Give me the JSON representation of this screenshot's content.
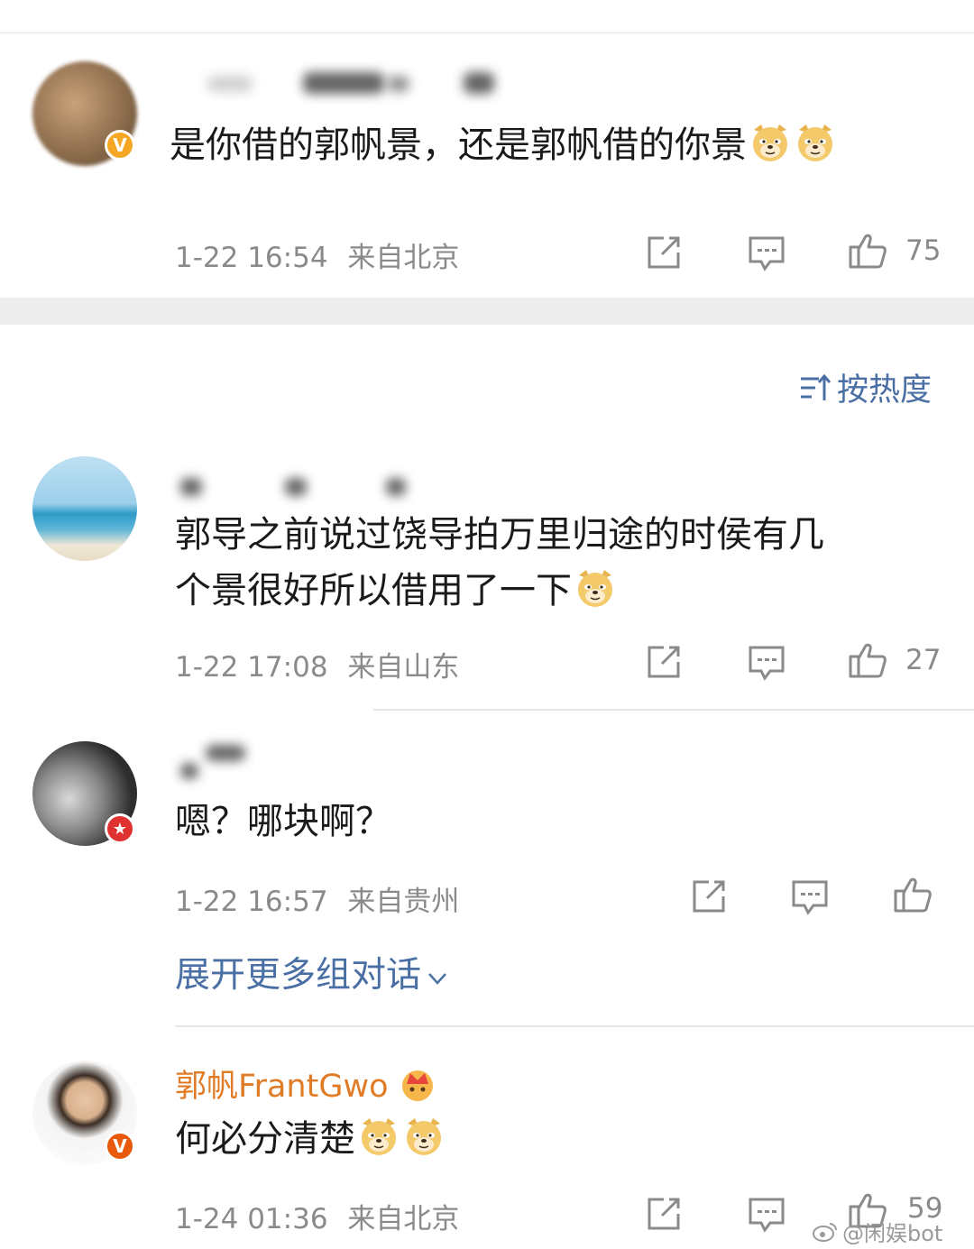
{
  "comments": [
    {
      "text": "是你借的郭帆景，还是郭帆借的你景",
      "emojis": [
        "doge",
        "doge"
      ],
      "time": "1-22 16:54",
      "location": "来自北京",
      "likes": "75"
    },
    {
      "text_line1": "郭导之前说过饶导拍万里归途的时侯有几",
      "text_line2": "个景很好所以借用了一下",
      "emojis": [
        "doge"
      ],
      "time": "1-22 17:08",
      "location": "来自山东",
      "likes": "27"
    },
    {
      "text": "嗯？哪块啊？",
      "time": "1-22 16:57",
      "location": "来自贵州",
      "likes": ""
    },
    {
      "author": "郭帆FrantGwo",
      "text": "何必分清楚",
      "emojis": [
        "doge",
        "doge"
      ],
      "time": "1-24 01:36",
      "location": "来自北京",
      "likes": "59"
    }
  ],
  "sort": {
    "label": "按热度",
    "icon": "sort-icon"
  },
  "expand": {
    "label": "展开更多组对话",
    "icon": "chevron-down-icon"
  },
  "watermark": {
    "text": "@闲娱bot",
    "icon": "weibo-icon"
  },
  "colors": {
    "link_blue": "#4a6fa5",
    "author_orange": "#e07b26",
    "meta_gray": "#8a8a8a"
  }
}
